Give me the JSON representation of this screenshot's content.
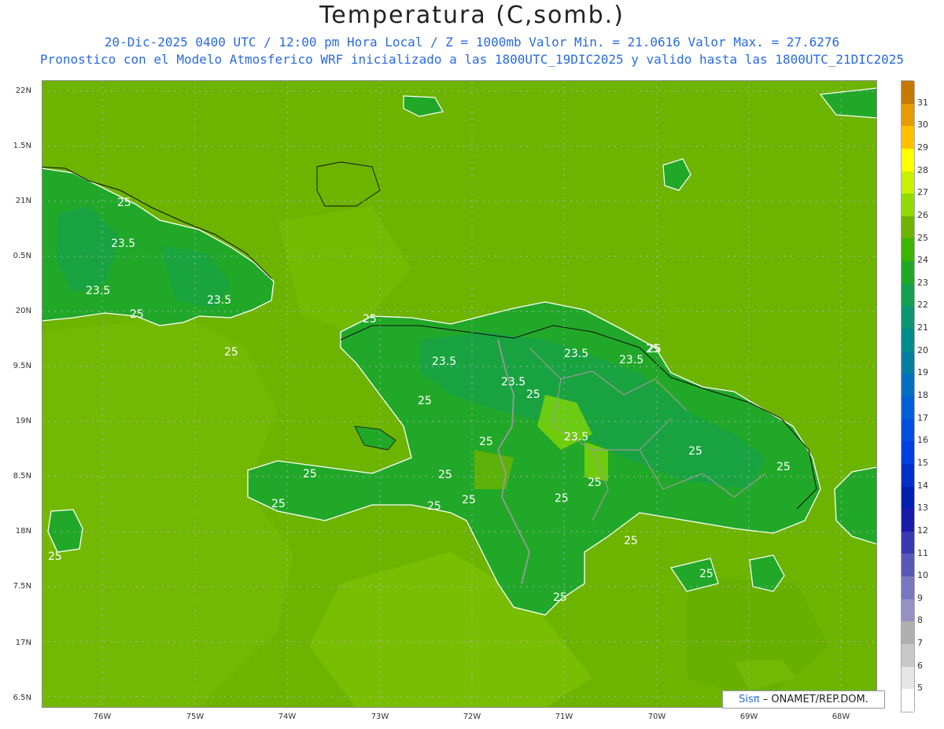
{
  "title": "Temperatura (C,somb.)",
  "subtitle_line1": "20-Dic-2025 0400 UTC / 12:00 pm Hora Local / Z = 1000mb  Valor Min. = 21.0616  Valor Max. = 27.6276",
  "subtitle_line2": "Pronostico con el Modelo Atmosferico WRF inicializado a las 1800UTC_19DIC2025 y valido hasta las  1800UTC_21DIC2025",
  "credit_sis": "Sisπ",
  "credit_rest": "– ONAMET/REP.DOM.",
  "y_labels": [
    "22N",
    "1.5N",
    "21N",
    "0.5N",
    "20N",
    "9.5N",
    "19N",
    "8.5N",
    "18N",
    "7.5N",
    "17N",
    "6.5N"
  ],
  "x_labels": [
    "76W",
    "75W",
    "74W",
    "73W",
    "72W",
    "71W",
    "70W",
    "69W",
    "68W"
  ],
  "colorbar": {
    "labels": [
      "31",
      "30",
      "29",
      "28",
      "27",
      "26",
      "25",
      "24",
      "23",
      "22",
      "21",
      "20",
      "19",
      "18",
      "17",
      "16",
      "15",
      "14",
      "13",
      "12",
      "11",
      "10",
      "9",
      "8",
      "7",
      "6",
      "5"
    ],
    "colors": [
      "#c47a00",
      "#e89a00",
      "#ffc000",
      "#ffff00",
      "#c8f000",
      "#90dc00",
      "#6cb400",
      "#3cb400",
      "#22a828",
      "#14a050",
      "#0a9670",
      "#008c8c",
      "#0080a0",
      "#0070c0",
      "#0060d8",
      "#0050e0",
      "#0040e0",
      "#0030c8",
      "#0020b0",
      "#1a1aa8",
      "#3a3ab0",
      "#5858b8",
      "#7878c0",
      "#9690c4",
      "#b0b0b0",
      "#c8c8c8",
      "#e6e6e6",
      "#ffffff"
    ]
  },
  "contour_labels": [
    "25",
    "23.5",
    "23.5",
    "23.5",
    "25",
    "25",
    "25",
    "23.5",
    "23.5",
    "23.5",
    "25",
    "25",
    "23.5",
    "25",
    "23.5",
    "25",
    "25",
    "25",
    "25",
    "25",
    "25",
    "25",
    "25",
    "25",
    "25",
    "25",
    "25",
    "25",
    "25",
    "25"
  ]
}
